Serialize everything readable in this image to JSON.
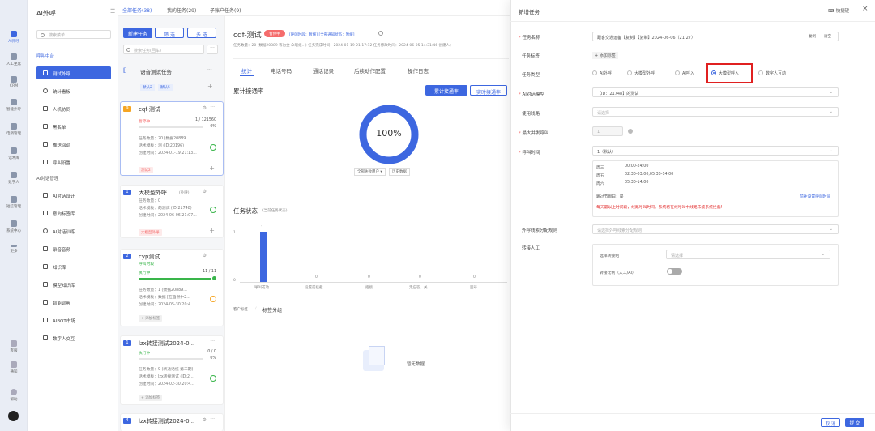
{
  "rail": [
    {
      "label": "AI外呼",
      "active": true
    },
    {
      "label": "人工坐席"
    },
    {
      "label": "CRM"
    },
    {
      "label": "智能外呼"
    },
    {
      "label": "电销管理"
    },
    {
      "label": "话术库"
    },
    {
      "label": "数字人"
    },
    {
      "label": "短信管理"
    },
    {
      "label": "系统中心"
    },
    {
      "label": "更多"
    }
  ],
  "rail_bottom": [
    "客服",
    "通知",
    "帮助"
  ],
  "sidebar": {
    "title": "AI外呼",
    "search_placeholder": "搜索菜单",
    "group1": "呼叫中台",
    "nav1": [
      {
        "label": "测试外呼",
        "active": true
      },
      {
        "label": "统计看板"
      },
      {
        "label": "人机协同"
      },
      {
        "label": "黑名单"
      },
      {
        "label": "推送回调"
      },
      {
        "label": "呼叫设置"
      }
    ],
    "group2": "AI对话管理",
    "nav2": [
      {
        "label": "AI对话设计"
      },
      {
        "label": "意向标签库"
      },
      {
        "label": "AI对话训练"
      },
      {
        "label": "录音音频"
      },
      {
        "label": "知识库"
      },
      {
        "label": "模型知识库"
      },
      {
        "label": "智能词典"
      },
      {
        "label": "AIBOT市场"
      },
      {
        "label": "数字人交互"
      }
    ]
  },
  "top_tabs": [
    "全部任务(38)",
    "我的任务(29)",
    "子账户任务(9)"
  ],
  "tasklist": {
    "new_btn": "新建任务",
    "filter_btn": "筛 选",
    "multi_btn": "多 选",
    "search_placeholder": "搜索任务(回车)",
    "group_title": "语音测试任务",
    "group_tags": [
      "默认2",
      "默认5"
    ],
    "cards": [
      {
        "num": "9",
        "name": "cqf-测试",
        "status": "暂停中",
        "count": "1 / 121560",
        "pct": "0%",
        "l1": "任务数量：20 (数据20889...",
        "l2": "话术模板：测 (ID:20196)",
        "l3": "创建时间：2024-01-19 21:13...",
        "tag": "测试2"
      },
      {
        "num": "1",
        "name": "大模型外呼",
        "sub": "(外呼)",
        "l1": "任务数量：0",
        "l2": "话术模板：的测试 (ID:21748)",
        "l3": "创建时间：2024-06-06 21:07...",
        "tag": "大模型外呼"
      },
      {
        "num": "2",
        "name": "cyp测试",
        "sub": "呼叫时段",
        "status": "执行中",
        "count": "11 / 11",
        "l1": "任务数量：1 (数据20889...",
        "l2": "话术模板：数据 [在自然中2...",
        "l3": "创建时间：2024-05-30 20:4...",
        "tag": "+ 添加标签"
      },
      {
        "num": "1",
        "name": "lzx转接测试2024-0...",
        "status": "执行中",
        "count": "0 / 0",
        "pct": "0%",
        "l1": "任务数量：9 (新通话统 第三期)",
        "l2": "话术模板：lzx转接测试 (ID:2...",
        "l3": "创建时间：2024-02-30 20:4...",
        "tag": "+ 添加标签"
      },
      {
        "num": "4",
        "name": "lzx转接测试2024-0..."
      }
    ]
  },
  "detail": {
    "title": "cqf-测试",
    "status": "暂停中",
    "meta1": "[呼叫时段：暂缓]  [全部通知状态：暂缓]",
    "meta2": "任务数量：20 (数据20889 等为全 众联组...)    任务完成时间：2024-01-19 21:17:12    任务修改时间：2024-06-05 14:31:46    创建人：",
    "tabs": [
      "统计",
      "电话号码",
      "通话记录",
      "后续动作配置",
      "操作日志"
    ],
    "cum_title": "累计接通率",
    "btn_cum": "累计接通率",
    "btn_rt": "实时接通率",
    "donut": "100%",
    "legend1": "全部失败用户 ▾",
    "legend2": "历史数据",
    "status_title": "任务状态",
    "status_sub": "(当前任务状态)",
    "bar_labels": [
      "呼叫成功",
      "设置前拦截",
      "拒接",
      "无应答、关...",
      "空号"
    ],
    "bar_vals": [
      "1",
      "0",
      "0",
      "0",
      "0"
    ],
    "y_ticks": [
      "1",
      "0"
    ],
    "bottom_tabs": [
      "客户标签",
      "标签分组"
    ],
    "empty": "暂无数据"
  },
  "drawer": {
    "title": "新增任务",
    "shortcut": "快捷键",
    "close": "×",
    "fields": {
      "name_label": "任务名称",
      "name_value": "跟客交通运备【复制】【复制】2024-06-06（21:27）",
      "copy_btn": "复制",
      "clear_btn": "清空",
      "tag_label": "任务标签",
      "tag_add": "+ 添加标签",
      "type_label": "任务类型",
      "types": [
        "AI外呼",
        "大模型外呼",
        "AI呼入",
        "大模型呼入",
        "数字人互动"
      ],
      "model_label": "AI对话模型",
      "model_value": "【ID：21748】的测试",
      "line_label": "使用线路",
      "line_ph": "请选择",
      "concur_label": "最大并发呼叫",
      "concur_value": "1",
      "time_label": "呼叫时间",
      "time_value": "1（默认）",
      "sched": [
        {
          "day": "周三",
          "time": "00:00-24:00"
        },
        {
          "day": "周五",
          "time": "02:30-03:00,05:30-14:00"
        },
        {
          "day": "周六",
          "time": "05:30-14:00"
        }
      ],
      "holiday": "跳过节假日：是",
      "set_link": "前往设置呼叫时间",
      "warn": "每天最以上时间段，线路呼叫时间。系统将在线呼叫中线路未被系统拦截!",
      "alloc_label": "外呼线索分配规则",
      "alloc_ph": "请选择外呼线索分配规则",
      "transfer_label": "转接人工",
      "transfer_group_label": "选择转接组",
      "transfer_group_ph": "请选择",
      "ratio_label": "转接比例（人工/AI）"
    },
    "cancel": "取 消",
    "submit": "提 交"
  },
  "colors": {
    "primary": "#3d67e0",
    "danger": "#f56c6c",
    "success": "#39b54a",
    "highlight_box": "#e02020"
  }
}
